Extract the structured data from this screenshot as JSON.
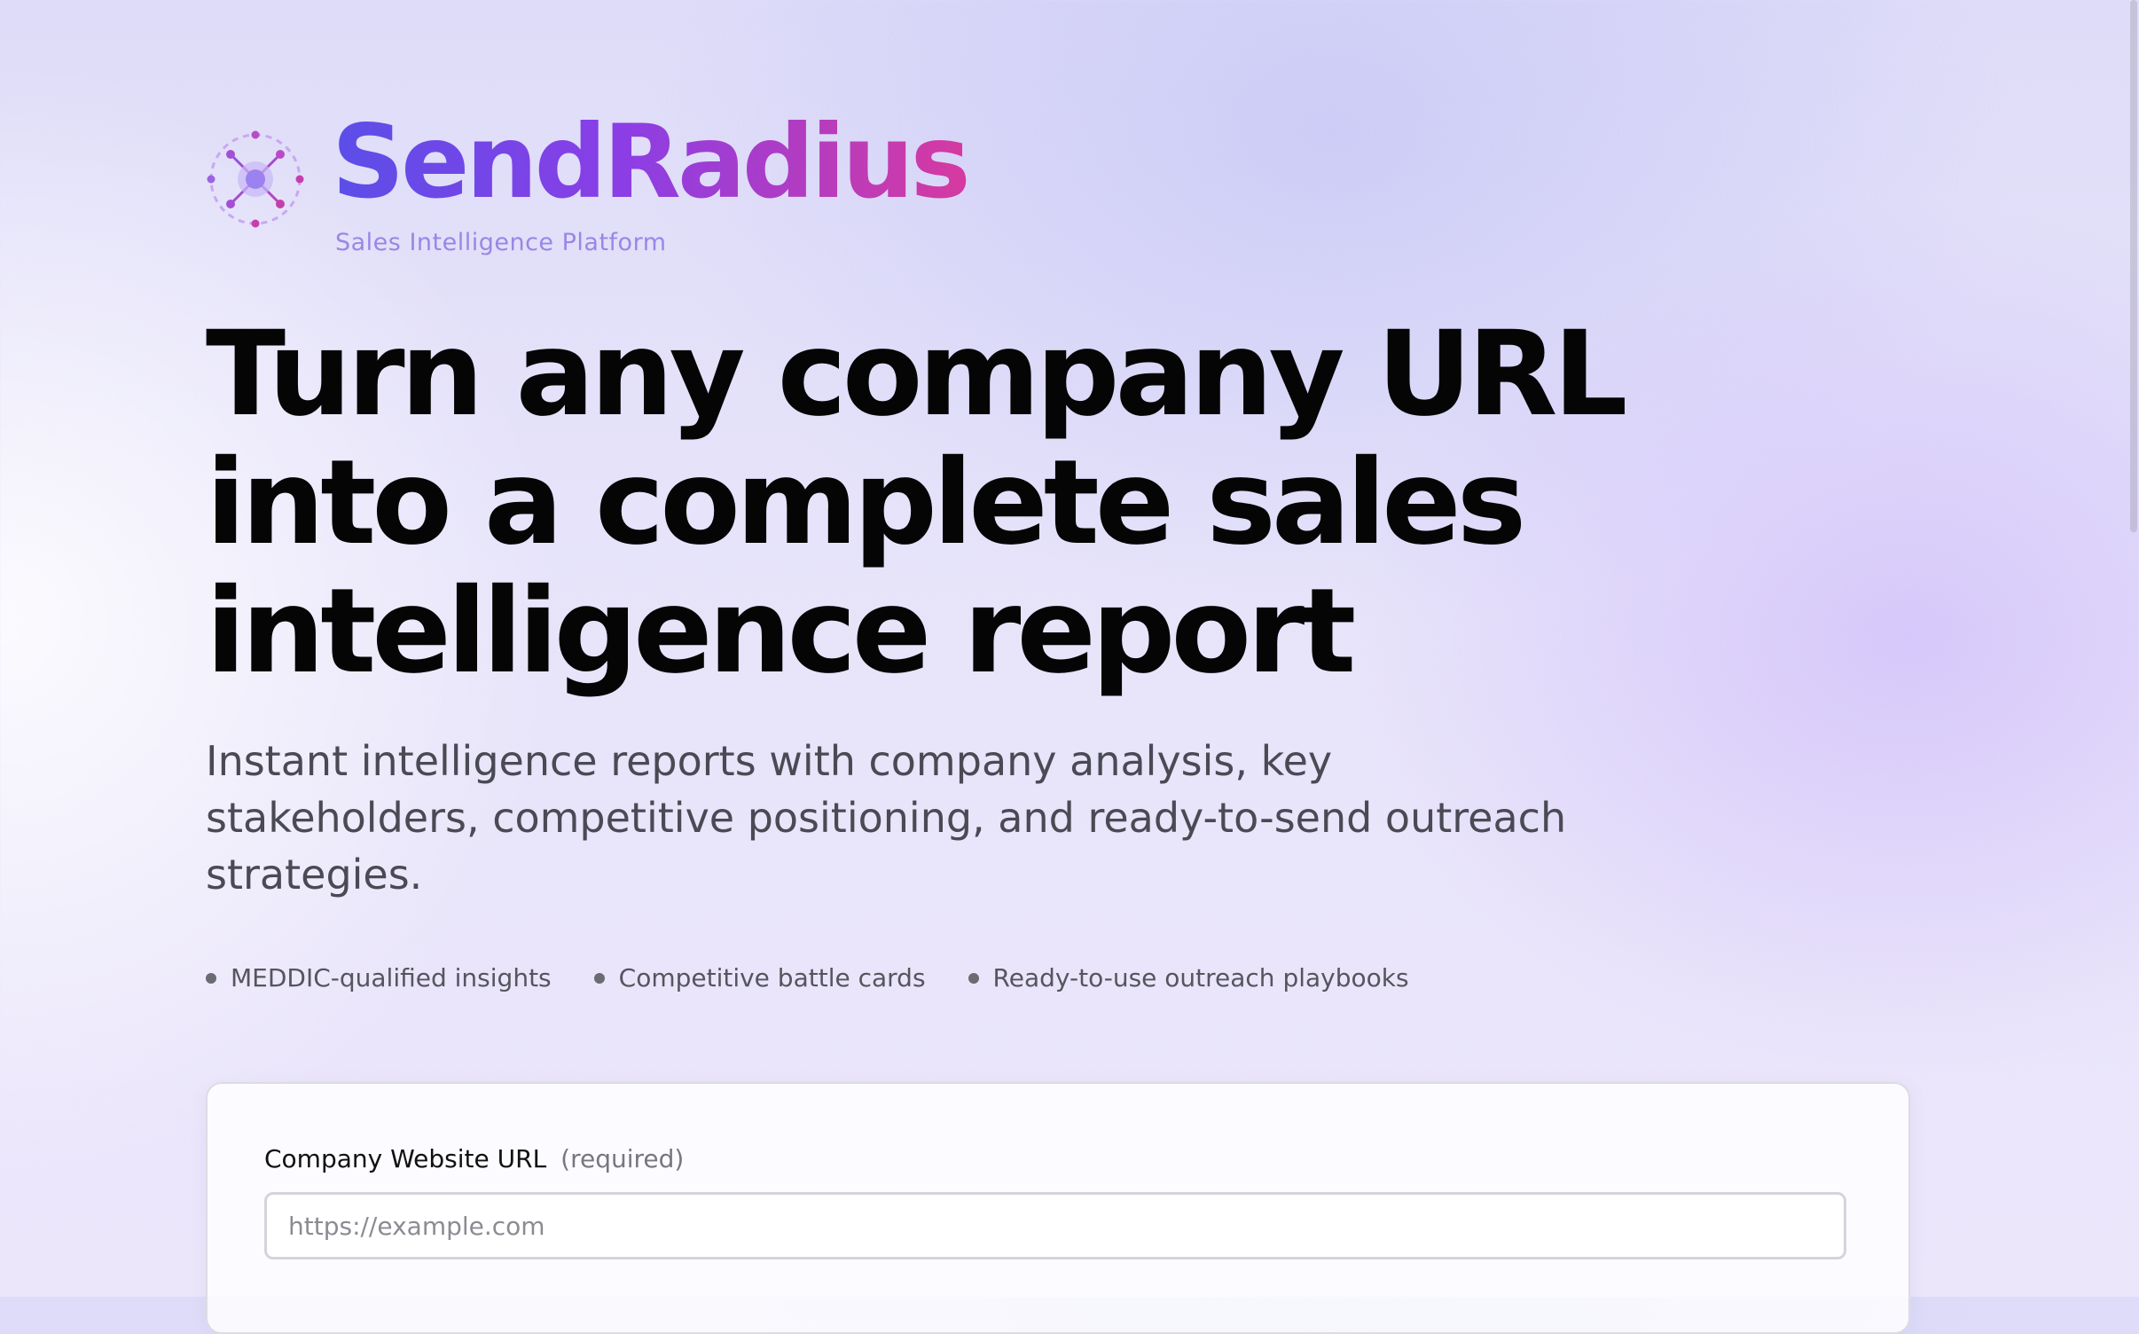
{
  "brand": {
    "name": "SendRadius",
    "tagline": "Sales Intelligence Platform",
    "logo_icon": "radius-network-icon",
    "gradient_colors": [
      "#5b4ee8",
      "#8a3ee6",
      "#d63aa0"
    ]
  },
  "hero": {
    "headline": "Turn any company URL into a complete sales intelligence report",
    "subheadline": "Instant intelligence reports with company analysis, key stakeholders, competitive positioning, and ready-to-send outreach strategies."
  },
  "features": [
    {
      "label": "MEDDIC-qualified insights"
    },
    {
      "label": "Competitive battle cards"
    },
    {
      "label": "Ready-to-use outreach playbooks"
    }
  ],
  "form": {
    "url_label": "Company Website URL",
    "url_hint": "(required)",
    "url_placeholder": "https://example.com",
    "url_value": ""
  }
}
